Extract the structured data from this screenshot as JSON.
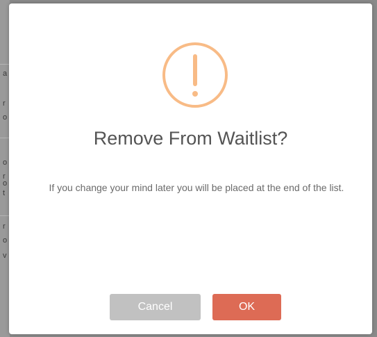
{
  "background": {
    "visible_chars": [
      "a",
      "r",
      "o",
      "o",
      "r",
      "o",
      "t",
      "r",
      "o",
      "v"
    ]
  },
  "dialog": {
    "icon": "warning-exclamation-icon",
    "icon_color": "#f8bb86",
    "title": "Remove From Waitlist?",
    "message": "If you change your mind later you will be placed at the end of the list.",
    "cancel_label": "Cancel",
    "cancel_color": "#c1c1c1",
    "ok_label": "OK",
    "ok_color": "#dd6b55"
  }
}
